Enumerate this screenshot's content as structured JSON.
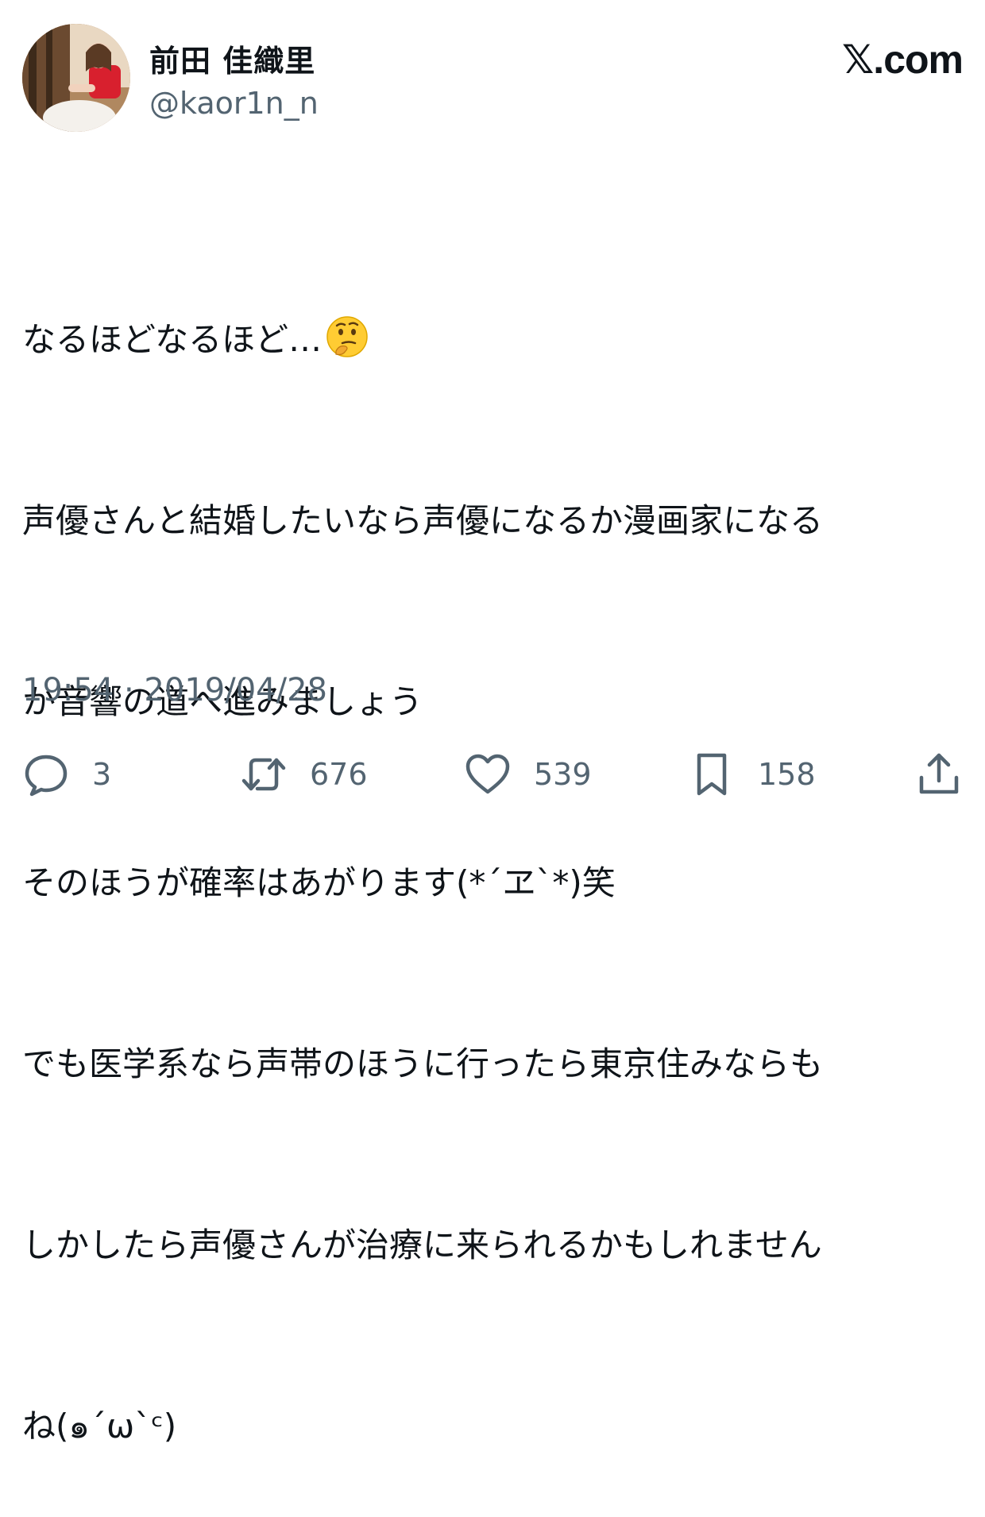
{
  "author": {
    "display_name": "前田 佳織里",
    "handle": "@kaor1n_n"
  },
  "brand": "𝕏.com",
  "tweet": {
    "lines": [
      "なるほどなるほど…",
      "声優さんと結婚したいなら声優になるか漫画家になる",
      "か音響の道へ進みましょう",
      "そのほうが確率はあがります(*´ヱ`*)笑",
      "でも医学系なら声帯のほうに行ったら東京住みならも",
      "しかしたら声優さんが治療に来られるかもしれません",
      "ね(๑´ω`ᶜ)"
    ],
    "emoji": "thinking-face-icon"
  },
  "timestamp": "19:54 · 2019/04/28",
  "actions": {
    "reply_count": "3",
    "retweet_count": "676",
    "like_count": "539",
    "bookmark_count": "158"
  }
}
